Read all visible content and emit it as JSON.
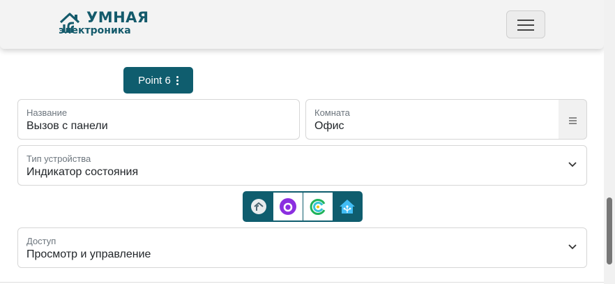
{
  "brand": {
    "line1": "УМНАЯ",
    "line2": "электроника",
    "color": "#145a6b"
  },
  "navbar": {
    "menu_icon": "hamburger-menu-icon"
  },
  "point": {
    "label": "Point 6",
    "menu_icon": "vertical-dots-icon",
    "color": "#0f5d6e"
  },
  "form": {
    "name": {
      "label": "Название",
      "value": "Вызов с панели"
    },
    "room": {
      "label": "Комната",
      "value": "Офис",
      "picker_icon": "list-icon"
    },
    "device_type": {
      "label": "Тип устройства",
      "value": "Индикатор состояния"
    },
    "access": {
      "label": "Доступ",
      "value": "Просмотр и управление"
    }
  },
  "integrations": [
    {
      "name": "custom-home-icon",
      "selected": false
    },
    {
      "name": "alice-icon",
      "selected": true
    },
    {
      "name": "salute-icon",
      "selected": true
    },
    {
      "name": "home-assistant-icon",
      "selected": false
    }
  ]
}
